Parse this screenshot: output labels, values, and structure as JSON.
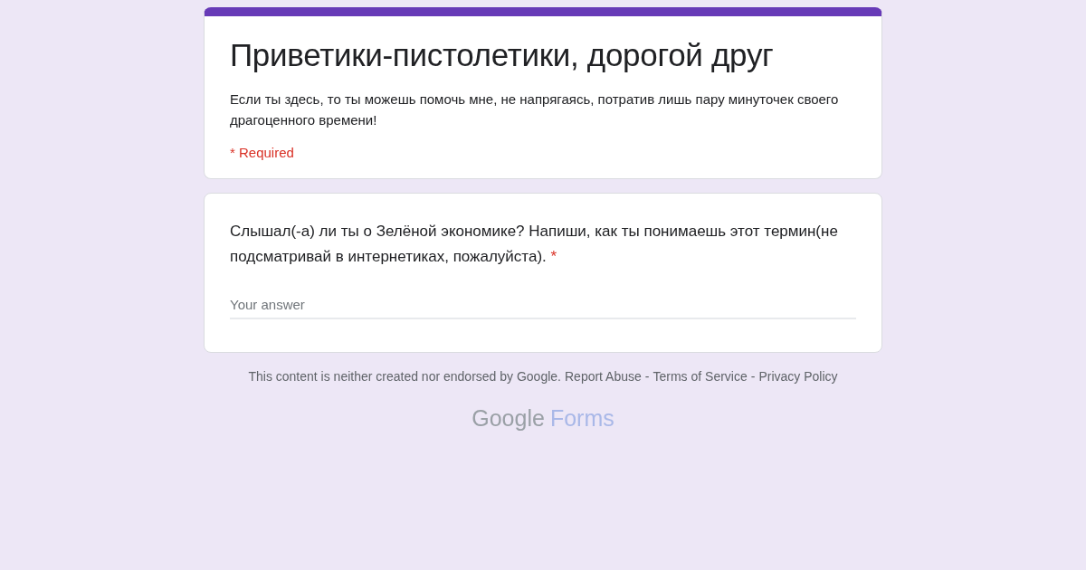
{
  "header": {
    "title": "Приветики-пистолетики, дорогой друг",
    "description": "Если ты здесь, то ты можешь помочь мне, не напрягаясь, потратив лишь пару минуточек своего драгоценного времени!",
    "required_note": "* Required"
  },
  "question": {
    "text": "Слышал(-а) ли ты о Зелёной экономике? Напиши, как ты понимаешь этот термин(не подсматривай в интернетиках, пожалуйста).",
    "required_mark": "*",
    "placeholder": "Your answer"
  },
  "footer": {
    "disclaimer": "This content is neither created nor endorsed by Google.",
    "separator": "-",
    "links": [
      "Report Abuse",
      "Terms of Service",
      "Privacy Policy"
    ]
  },
  "logo": {
    "brand": "Google",
    "product": "Forms"
  }
}
